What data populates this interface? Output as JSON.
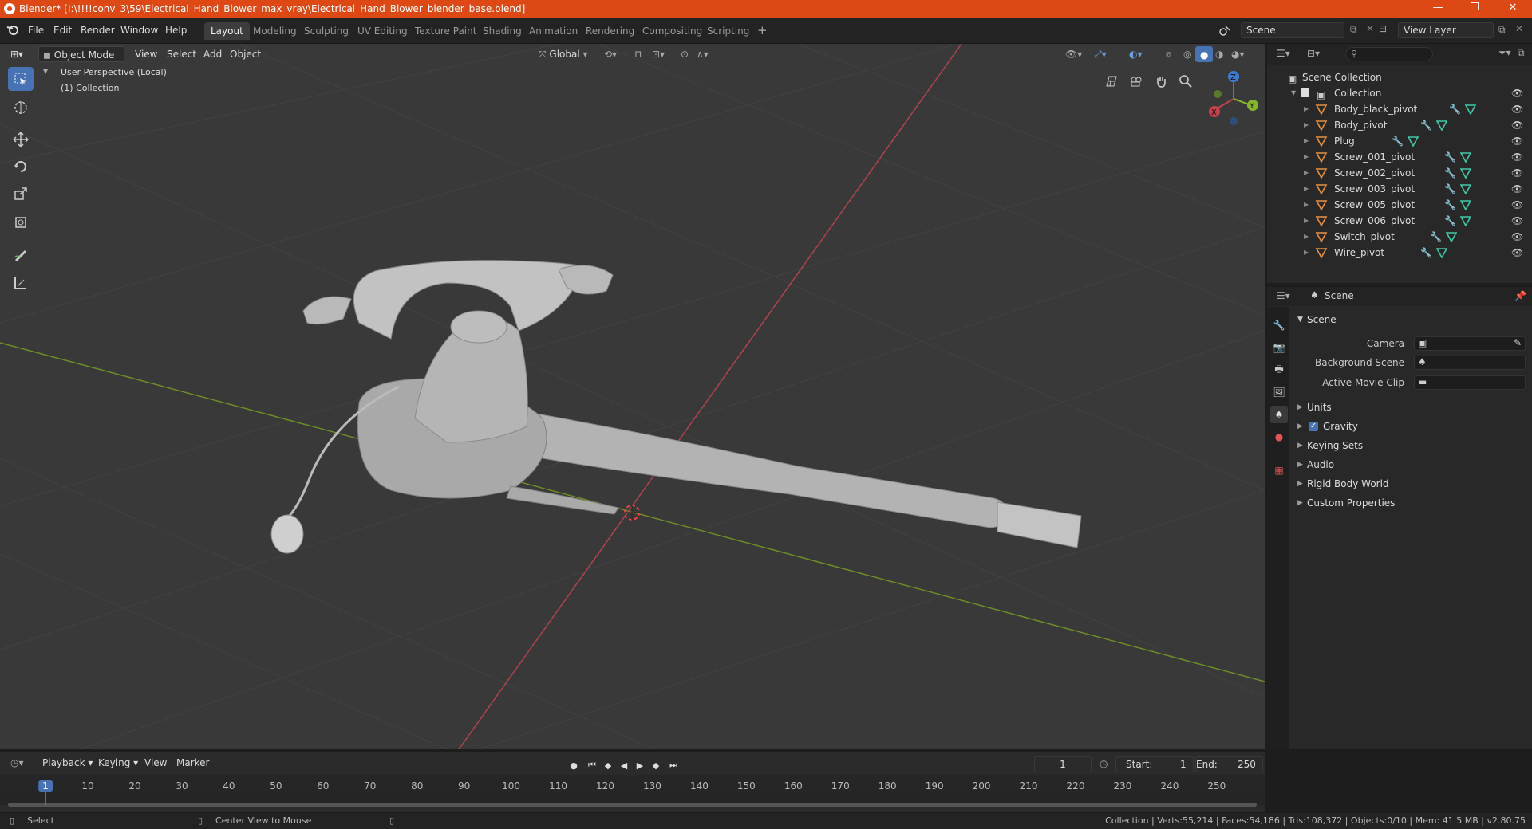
{
  "titlebar": {
    "title": "Blender* [I:\\!!!!conv_3\\59\\Electrical_Hand_Blower_max_vray\\Electrical_Hand_Blower_blender_base.blend]",
    "minimize": "—",
    "maximize": "❐",
    "close": "✕"
  },
  "menu": {
    "file": "File",
    "edit": "Edit",
    "render": "Render",
    "window": "Window",
    "help": "Help"
  },
  "workspaces": [
    "Layout",
    "Modeling",
    "Sculpting",
    "UV Editing",
    "Texture Paint",
    "Shading",
    "Animation",
    "Rendering",
    "Compositing",
    "Scripting"
  ],
  "workspace_add": "+",
  "scene_field": "Scene",
  "view_layer_field": "View Layer",
  "viewport_header": {
    "mode": "Object Mode",
    "view": "View",
    "select": "Select",
    "add": "Add",
    "object": "Object",
    "orientation": "Global"
  },
  "viewport": {
    "perspective": "User Perspective (Local)",
    "collection": "(1) Collection",
    "gizmo": {
      "z": "Z",
      "y": "Y",
      "x": "X"
    }
  },
  "outliner": {
    "root": "Scene Collection",
    "collection": "Collection",
    "items": [
      {
        "name": "Body_black_pivot"
      },
      {
        "name": "Body_pivot"
      },
      {
        "name": "Plug"
      },
      {
        "name": "Screw_001_pivot"
      },
      {
        "name": "Screw_002_pivot"
      },
      {
        "name": "Screw_003_pivot"
      },
      {
        "name": "Screw_005_pivot"
      },
      {
        "name": "Screw_006_pivot"
      },
      {
        "name": "Switch_pivot"
      },
      {
        "name": "Wire_pivot"
      }
    ]
  },
  "properties": {
    "context": "Scene",
    "section": "Scene",
    "camera_label": "Camera",
    "background_label": "Background Scene",
    "movieclip_label": "Active Movie Clip",
    "panels": [
      "Units",
      "Gravity",
      "Keying Sets",
      "Audio",
      "Rigid Body World",
      "Custom Properties"
    ],
    "gravity_checked": true
  },
  "timeline": {
    "playback": "Playback",
    "keying": "Keying",
    "view": "View",
    "marker": "Marker",
    "current_frame": "1",
    "start_label": "Start:",
    "start": "1",
    "end_label": "End:",
    "end": "250",
    "ticks": [
      "1",
      "10",
      "20",
      "30",
      "40",
      "50",
      "60",
      "70",
      "80",
      "90",
      "100",
      "110",
      "120",
      "130",
      "140",
      "150",
      "160",
      "170",
      "180",
      "190",
      "200",
      "210",
      "220",
      "230",
      "240",
      "250"
    ]
  },
  "status": {
    "select": "Select",
    "center": "Center View to Mouse",
    "stats": "Collection | Verts:55,214 | Faces:54,186 | Tris:108,372 | Objects:0/10 | Mem: 41.5 MB | v2.80.75"
  },
  "colors": {
    "titlebar": "#dd4814",
    "accent": "#4772b3",
    "x_axis": "#c8414a",
    "y_axis": "#84b52a",
    "z_axis": "#3d7ad6"
  }
}
